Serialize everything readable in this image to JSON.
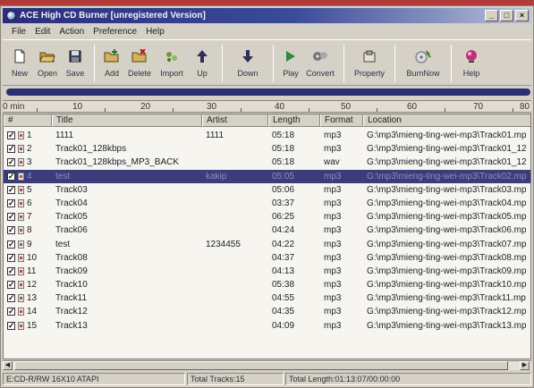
{
  "window": {
    "title": "ACE High CD Burner [unregistered Version]",
    "controls": [
      "_",
      "□",
      "×"
    ]
  },
  "menu": [
    "File",
    "Edit",
    "Action",
    "Preference",
    "Help"
  ],
  "toolbar": [
    {
      "label": "New",
      "icon": "new-document-icon"
    },
    {
      "label": "Open",
      "icon": "open-folder-icon"
    },
    {
      "label": "Save",
      "icon": "save-disk-icon"
    },
    {
      "label": "Add",
      "icon": "add-folder-icon"
    },
    {
      "label": "Delete",
      "icon": "delete-folder-icon"
    },
    {
      "label": "Import",
      "icon": "import-icon"
    },
    {
      "label": "Up",
      "icon": "arrow-up-icon"
    },
    {
      "label": "Down",
      "icon": "arrow-down-icon"
    },
    {
      "label": "Play",
      "icon": "play-icon"
    },
    {
      "label": "Convert",
      "icon": "convert-icon"
    },
    {
      "label": "Property",
      "icon": "property-icon"
    },
    {
      "label": "BurnNow",
      "icon": "burn-now-icon"
    },
    {
      "label": "Help",
      "icon": "help-icon"
    }
  ],
  "ruler": {
    "ticks": [
      "0 min",
      "10",
      "20",
      "30",
      "40",
      "50",
      "60",
      "70",
      "80"
    ]
  },
  "columns": [
    "#",
    "Title",
    "Artist",
    "Length",
    "Format",
    "Location"
  ],
  "tracks": [
    {
      "num": "1",
      "title": "1111",
      "artist": "1111",
      "length": "05:18",
      "format": "mp3",
      "location": "G:\\mp3\\mieng-ting-wei-mp3\\Track01.mp",
      "checked": true,
      "selected": false
    },
    {
      "num": "2",
      "title": "Track01_128kbps",
      "artist": "",
      "length": "05:18",
      "format": "mp3",
      "location": "G:\\mp3\\mieng-ting-wei-mp3\\Track01_12",
      "checked": true,
      "selected": false
    },
    {
      "num": "3",
      "title": "Track01_128kbps_MP3_BACK",
      "artist": "",
      "length": "05:18",
      "format": "wav",
      "location": "G:\\mp3\\mieng-ting-wei-mp3\\Track01_12",
      "checked": true,
      "selected": false
    },
    {
      "num": "4",
      "title": "test",
      "artist": "kakip",
      "length": "05:05",
      "format": "mp3",
      "location": "G:\\mp3\\mieng-ting-wei-mp3\\Track02.mp",
      "checked": true,
      "selected": true
    },
    {
      "num": "5",
      "title": "Track03",
      "artist": "",
      "length": "05:06",
      "format": "mp3",
      "location": "G:\\mp3\\mieng-ting-wei-mp3\\Track03.mp",
      "checked": true,
      "selected": false
    },
    {
      "num": "6",
      "title": "Track04",
      "artist": "",
      "length": "03:37",
      "format": "mp3",
      "location": "G:\\mp3\\mieng-ting-wei-mp3\\Track04.mp",
      "checked": true,
      "selected": false
    },
    {
      "num": "7",
      "title": "Track05",
      "artist": "",
      "length": "06:25",
      "format": "mp3",
      "location": "G:\\mp3\\mieng-ting-wei-mp3\\Track05.mp",
      "checked": true,
      "selected": false
    },
    {
      "num": "8",
      "title": "Track06",
      "artist": "",
      "length": "04:24",
      "format": "mp3",
      "location": "G:\\mp3\\mieng-ting-wei-mp3\\Track06.mp",
      "checked": true,
      "selected": false
    },
    {
      "num": "9",
      "title": "test",
      "artist": "1234455",
      "length": "04:22",
      "format": "mp3",
      "location": "G:\\mp3\\mieng-ting-wei-mp3\\Track07.mp",
      "checked": true,
      "selected": false
    },
    {
      "num": "10",
      "title": "Track08",
      "artist": "",
      "length": "04:37",
      "format": "mp3",
      "location": "G:\\mp3\\mieng-ting-wei-mp3\\Track08.mp",
      "checked": true,
      "selected": false
    },
    {
      "num": "11",
      "title": "Track09",
      "artist": "",
      "length": "04:13",
      "format": "mp3",
      "location": "G:\\mp3\\mieng-ting-wei-mp3\\Track09.mp",
      "checked": true,
      "selected": false
    },
    {
      "num": "12",
      "title": "Track10",
      "artist": "",
      "length": "05:38",
      "format": "mp3",
      "location": "G:\\mp3\\mieng-ting-wei-mp3\\Track10.mp",
      "checked": true,
      "selected": false
    },
    {
      "num": "13",
      "title": "Track11",
      "artist": "",
      "length": "04:55",
      "format": "mp3",
      "location": "G:\\mp3\\mieng-ting-wei-mp3\\Track11.mp",
      "checked": true,
      "selected": false
    },
    {
      "num": "14",
      "title": "Track12",
      "artist": "",
      "length": "04:35",
      "format": "mp3",
      "location": "G:\\mp3\\mieng-ting-wei-mp3\\Track12.mp",
      "checked": true,
      "selected": false
    },
    {
      "num": "15",
      "title": "Track13",
      "artist": "",
      "length": "04:09",
      "format": "mp3",
      "location": "G:\\mp3\\mieng-ting-wei-mp3\\Track13.mp",
      "checked": true,
      "selected": false
    }
  ],
  "scroll": {
    "left_arrow": "◀",
    "right_arrow": "▶"
  },
  "status": {
    "drive": "E:CD-R/RW 16X10 ATAPI",
    "total_tracks": "Total Tracks:15",
    "total_length": "Total Length:01:13:07/00:00:00"
  }
}
